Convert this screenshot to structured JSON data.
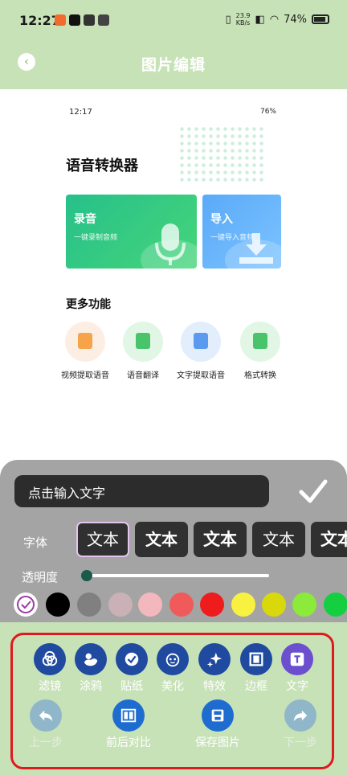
{
  "status_bar": {
    "time": "12:27",
    "net_speed_value": "23.9",
    "net_speed_unit": "KB/s",
    "battery": "74%"
  },
  "header": {
    "title": "图片编辑",
    "back_icon": "back-icon"
  },
  "preview": {
    "status_time": "12:17",
    "status_battery": "76%",
    "app_title": "语音转换器",
    "cards": [
      {
        "title": "录音",
        "subtitle": "一键录制音频",
        "icon": "microphone-icon"
      },
      {
        "title": "导入",
        "subtitle": "一键导入音频",
        "icon": "download-icon"
      }
    ],
    "more_title": "更多功能",
    "features": [
      {
        "label": "视频提取语音",
        "icon": "video-icon",
        "bg": "#fdeee3",
        "fg": "#f6a34a"
      },
      {
        "label": "语音翻译",
        "icon": "waveform-icon",
        "bg": "#e2f6e6",
        "fg": "#4ac46a"
      },
      {
        "label": "文字提取语音",
        "icon": "text-t-icon",
        "bg": "#e3eefc",
        "fg": "#5b9bef"
      },
      {
        "label": "格式转换",
        "icon": "document-icon",
        "bg": "#e2f6e6",
        "fg": "#4ac46a"
      }
    ]
  },
  "editor": {
    "text_placeholder": "点击输入文字",
    "font_label": "字体",
    "font_samples": [
      "文本",
      "文本",
      "文本",
      "文本",
      "文本"
    ],
    "opacity_label": "透明度",
    "opacity_level": 0,
    "colors": [
      "none",
      "#000000",
      "#808080",
      "#c9b1b5",
      "#f2b8bd",
      "#f05a5a",
      "#ee1c1c",
      "#f8f140",
      "#d9d80a",
      "#8cea3a",
      "#14d040"
    ]
  },
  "tools": [
    {
      "label": "滤镜",
      "icon": "filter-icon"
    },
    {
      "label": "涂鸦",
      "icon": "duck-icon"
    },
    {
      "label": "贴纸",
      "icon": "sticker-icon"
    },
    {
      "label": "美化",
      "icon": "beautify-icon"
    },
    {
      "label": "特效",
      "icon": "sparkle-icon"
    },
    {
      "label": "边框",
      "icon": "frame-icon"
    },
    {
      "label": "文字",
      "icon": "text-icon"
    }
  ],
  "actions": [
    {
      "label": "上一步",
      "icon": "undo-icon",
      "enabled": false
    },
    {
      "label": "前后对比",
      "icon": "compare-icon",
      "enabled": true
    },
    {
      "label": "保存图片",
      "icon": "save-icon",
      "enabled": true
    },
    {
      "label": "下一步",
      "icon": "redo-icon",
      "enabled": false
    }
  ]
}
